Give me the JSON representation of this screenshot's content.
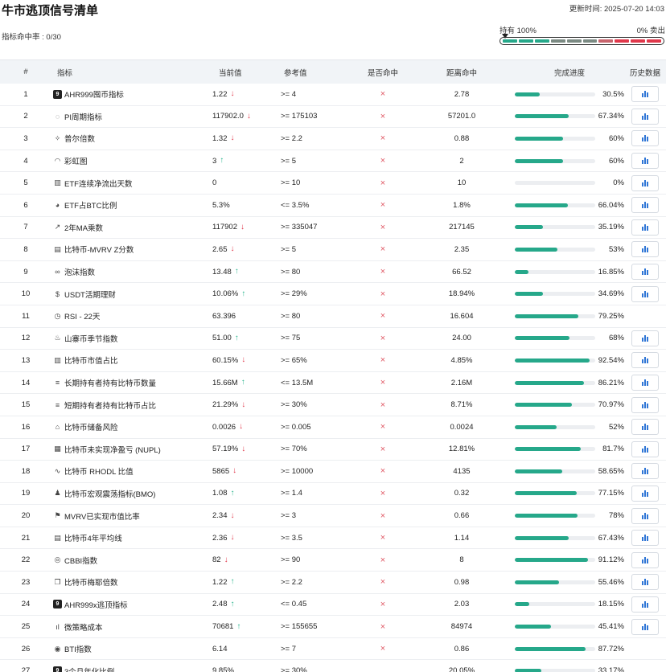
{
  "header": {
    "title": "牛市逃顶信号清单",
    "updated": "更新时间: 2025-07-20 14:03",
    "hit_rate": "指标命中率 : 0/30"
  },
  "gauge": {
    "left_label": "持有 100%",
    "right_label": "0% 卖出",
    "segment_colors": [
      "#26a88a",
      "#26a88a",
      "#26a88a",
      "#7b8a83",
      "#7b8a83",
      "#7b8a83",
      "#c8646d",
      "#e0384b",
      "#e0384b",
      "#e0384b"
    ]
  },
  "columns": [
    "#",
    "指标",
    "当前值",
    "参考值",
    "是否命中",
    "距离命中",
    "完成进度",
    "历史数据"
  ],
  "colors": {
    "up": "#2bb58e",
    "down": "#e0384b",
    "progress": "#26a88a",
    "hist": "#2f76d6"
  },
  "rows": [
    {
      "idx": "1",
      "icon": "9",
      "name": "AHR999囤币指标",
      "current": "1.22",
      "trend": "down",
      "ref": ">= 4",
      "hit": "×",
      "distance": "2.78",
      "progress": 30.5,
      "pct": "30.5%",
      "hist": true
    },
    {
      "idx": "2",
      "icon": "circle",
      "name": "PI周期指标",
      "current": "117902.0",
      "trend": "down",
      "ref": ">= 175103",
      "hit": "×",
      "distance": "57201.0",
      "progress": 67.34,
      "pct": "67.34%",
      "hist": true
    },
    {
      "idx": "3",
      "icon": "sparkle",
      "name": "普尔倍数",
      "current": "1.32",
      "trend": "down",
      "ref": ">= 2.2",
      "hit": "×",
      "distance": "0.88",
      "progress": 60,
      "pct": "60%",
      "hist": true
    },
    {
      "idx": "4",
      "icon": "rainbow",
      "name": "彩虹图",
      "current": "3",
      "trend": "up",
      "ref": ">= 5",
      "hit": "×",
      "distance": "2",
      "progress": 60,
      "pct": "60%",
      "hist": true
    },
    {
      "idx": "5",
      "icon": "bars",
      "name": "ETF连续净流出天数",
      "current": "0",
      "trend": "",
      "ref": ">= 10",
      "hit": "×",
      "distance": "10",
      "progress": 0,
      "pct": "0%",
      "hist": true
    },
    {
      "idx": "6",
      "icon": "pie",
      "name": "ETF占BTC比例",
      "current": "5.3%",
      "trend": "",
      "ref": "<= 3.5%",
      "hit": "×",
      "distance": "1.8%",
      "progress": 66.04,
      "pct": "66.04%",
      "hist": true
    },
    {
      "idx": "7",
      "icon": "line",
      "name": "2年MA乘数",
      "current": "117902",
      "trend": "down",
      "ref": ">= 335047",
      "hit": "×",
      "distance": "217145",
      "progress": 35.19,
      "pct": "35.19%",
      "hist": true
    },
    {
      "idx": "8",
      "icon": "clipboard",
      "name": "比特币-MVRV Z分数",
      "current": "2.65",
      "trend": "down",
      "ref": ">= 5",
      "hit": "×",
      "distance": "2.35",
      "progress": 53,
      "pct": "53%",
      "hist": true
    },
    {
      "idx": "9",
      "icon": "bubble",
      "name": "泡沫指数",
      "current": "13.48",
      "trend": "up",
      "ref": ">= 80",
      "hit": "×",
      "distance": "66.52",
      "progress": 16.85,
      "pct": "16.85%",
      "hist": true
    },
    {
      "idx": "10",
      "icon": "dollar",
      "name": "USDT活期理财",
      "current": "10.06%",
      "trend": "up",
      "ref": ">= 29%",
      "hit": "×",
      "distance": "18.94%",
      "progress": 34.69,
      "pct": "34.69%",
      "hist": true
    },
    {
      "idx": "11",
      "icon": "clock",
      "name": "RSI - 22天",
      "current": "63.396",
      "trend": "",
      "ref": ">= 80",
      "hit": "×",
      "distance": "16.604",
      "progress": 79.25,
      "pct": "79.25%",
      "hist": false
    },
    {
      "idx": "12",
      "icon": "flame",
      "name": "山寨币季节指数",
      "current": "51.00",
      "trend": "up",
      "ref": ">= 75",
      "hit": "×",
      "distance": "24.00",
      "progress": 68,
      "pct": "68%",
      "hist": true
    },
    {
      "idx": "13",
      "icon": "bars",
      "name": "比特币市值占比",
      "current": "60.15%",
      "trend": "down",
      "ref": ">= 65%",
      "hit": "×",
      "distance": "4.85%",
      "progress": 92.54,
      "pct": "92.54%",
      "hist": true
    },
    {
      "idx": "14",
      "icon": "database",
      "name": "长期持有者持有比特币数量",
      "current": "15.66M",
      "trend": "up",
      "ref": "<= 13.5M",
      "hit": "×",
      "distance": "2.16M",
      "progress": 86.21,
      "pct": "86.21%",
      "hist": true
    },
    {
      "idx": "15",
      "icon": "database",
      "name": "短期持有者持有比特币占比",
      "current": "21.29%",
      "trend": "down",
      "ref": ">= 30%",
      "hit": "×",
      "distance": "8.71%",
      "progress": 70.97,
      "pct": "70.97%",
      "hist": true
    },
    {
      "idx": "16",
      "icon": "bank",
      "name": "比特币储备风险",
      "current": "0.0026",
      "trend": "down",
      "ref": ">= 0.005",
      "hit": "×",
      "distance": "0.0024",
      "progress": 52,
      "pct": "52%",
      "hist": true
    },
    {
      "idx": "17",
      "icon": "calendar",
      "name": "比特币未实现净盈亏 (NUPL)",
      "current": "57.19%",
      "trend": "down",
      "ref": ">= 70%",
      "hit": "×",
      "distance": "12.81%",
      "progress": 81.7,
      "pct": "81.7%",
      "hist": true
    },
    {
      "idx": "18",
      "icon": "pulse",
      "name": "比特币 RHODL 比值",
      "current": "5865",
      "trend": "down",
      "ref": ">= 10000",
      "hit": "×",
      "distance": "4135",
      "progress": 58.65,
      "pct": "58.65%",
      "hist": true
    },
    {
      "idx": "19",
      "icon": "person",
      "name": "比特币宏观震荡指标(BMO)",
      "current": "1.08",
      "trend": "up",
      "ref": ">= 1.4",
      "hit": "×",
      "distance": "0.32",
      "progress": 77.15,
      "pct": "77.15%",
      "hist": true
    },
    {
      "idx": "20",
      "icon": "flag",
      "name": "MVRV已实现市值比率",
      "current": "2.34",
      "trend": "down",
      "ref": ">= 3",
      "hit": "×",
      "distance": "0.66",
      "progress": 78,
      "pct": "78%",
      "hist": true
    },
    {
      "idx": "21",
      "icon": "doc",
      "name": "比特币4年平均线",
      "current": "2.36",
      "trend": "down",
      "ref": ">= 3.5",
      "hit": "×",
      "distance": "1.14",
      "progress": 67.43,
      "pct": "67.43%",
      "hist": true
    },
    {
      "idx": "22",
      "icon": "coin",
      "name": "CBBI指数",
      "current": "82",
      "trend": "down",
      "ref": ">= 90",
      "hit": "×",
      "distance": "8",
      "progress": 91.12,
      "pct": "91.12%",
      "hist": true
    },
    {
      "idx": "23",
      "icon": "copy",
      "name": "比特币梅耶倍数",
      "current": "1.22",
      "trend": "up",
      "ref": ">= 2.2",
      "hit": "×",
      "distance": "0.98",
      "progress": 55.46,
      "pct": "55.46%",
      "hist": true
    },
    {
      "idx": "24",
      "icon": "9",
      "name": "AHR999x逃顶指标",
      "current": "2.48",
      "trend": "up",
      "ref": "<= 0.45",
      "hit": "×",
      "distance": "2.03",
      "progress": 18.15,
      "pct": "18.15%",
      "hist": true
    },
    {
      "idx": "25",
      "icon": "smallbars",
      "name": "微策略成本",
      "current": "70681",
      "trend": "up",
      "ref": ">= 155655",
      "hit": "×",
      "distance": "84974",
      "progress": 45.41,
      "pct": "45.41%",
      "hist": true
    },
    {
      "idx": "26",
      "icon": "target",
      "name": "BTI指数",
      "current": "6.14",
      "trend": "",
      "ref": ">= 7",
      "hit": "×",
      "distance": "0.86",
      "progress": 87.72,
      "pct": "87.72%",
      "hist": false
    },
    {
      "idx": "27",
      "icon": "9",
      "name": "3个月年化比例",
      "current": "9.85%",
      "trend": "",
      "ref": ">= 30%",
      "hit": "",
      "distance": "20.05%",
      "progress": 33.17,
      "pct": "33.17%",
      "hist": false
    }
  ]
}
